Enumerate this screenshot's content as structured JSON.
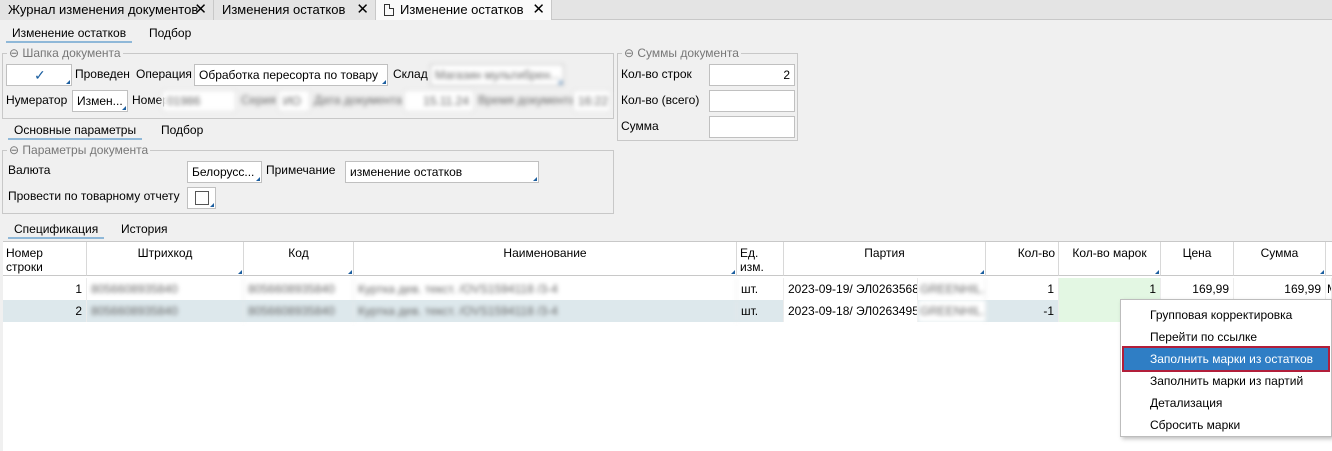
{
  "window_tabs": [
    {
      "label": "Журнал изменения документов"
    },
    {
      "label": "Изменения остатков"
    },
    {
      "label": "Изменение остатков"
    }
  ],
  "close_glyph": "✕",
  "top_subtabs": [
    "Изменение остатков",
    "Подбор"
  ],
  "header_group": {
    "title": "⊖ Шапка документа",
    "posted_label": "Проведен",
    "operation_label": "Операция",
    "operation_value": "Обработка пересорта по товару",
    "warehouse_label": "Склад",
    "warehouse_value": "Магазин мультибрен...",
    "numerator_label": "Нумератор",
    "numerator_value": "Измен...",
    "number_label": "Номер",
    "number_value": "01986",
    "series_label": "Серия",
    "series_value": "ИО",
    "date_label": "Дата документа",
    "date_value": "15.11.24",
    "time_label": "Время документа",
    "time_value": "16:22"
  },
  "sums_group": {
    "title": "⊖ Суммы документа",
    "rows_label": "Кол-во строк",
    "rows_value": "2",
    "qty_label": "Кол-во (всего)",
    "qty_value": "",
    "sum_label": "Сумма",
    "sum_value": ""
  },
  "mid_subtabs": [
    "Основные параметры",
    "Подбор"
  ],
  "params_group": {
    "title": "⊖ Параметры документа",
    "currency_label": "Валюта",
    "currency_value": "Белорусс...",
    "note_label": "Примечание",
    "note_value": "изменение остатков",
    "post_report_label": "Провести по товарному отчету"
  },
  "bottom_subtabs": [
    "Спецификация",
    "История"
  ],
  "grid": {
    "columns": [
      "Номер строки",
      "Штрихкод",
      "Код",
      "Наименование",
      "Ед. изм.",
      "Партия",
      "Кол-во",
      "Кол-во марок",
      "Цена",
      "Сумма"
    ],
    "rows": [
      {
        "num": "1",
        "barcode": "8056608935840",
        "code": "8056608935840",
        "name": "Куртка дев. текст. /OVS1594118 /3-4",
        "unit": "шт.",
        "batch": "2023-09-19/ ЭЛ0263568/",
        "batch_tail": "GREENHIL...",
        "qty": "1",
        "marks": "1",
        "price": "169,99",
        "sum": "169,99"
      },
      {
        "num": "2",
        "barcode": "8056608935840",
        "code": "8056608935840",
        "name": "Куртка дев. текст. /OVS1594118 /3-4",
        "unit": "шт.",
        "batch": "2023-09-18/ ЭЛ0263495/",
        "batch_tail": "GREENHIL...",
        "qty": "-1",
        "marks": "",
        "price": "",
        "sum": ""
      }
    ],
    "overflow_char": "М"
  },
  "context_menu": {
    "items": [
      "Групповая корректировка",
      "Перейти по ссылке",
      "Заполнить марки из остатков",
      "Заполнить марки из партий",
      "Детализация",
      "Сбросить марки"
    ],
    "highlighted_index": 2
  },
  "colors": {
    "highlight": "#2f7ec5",
    "highlight_outline": "#b21e3a",
    "row_selected": "#dde8ec",
    "marks_cell": "#e3f7e3"
  }
}
